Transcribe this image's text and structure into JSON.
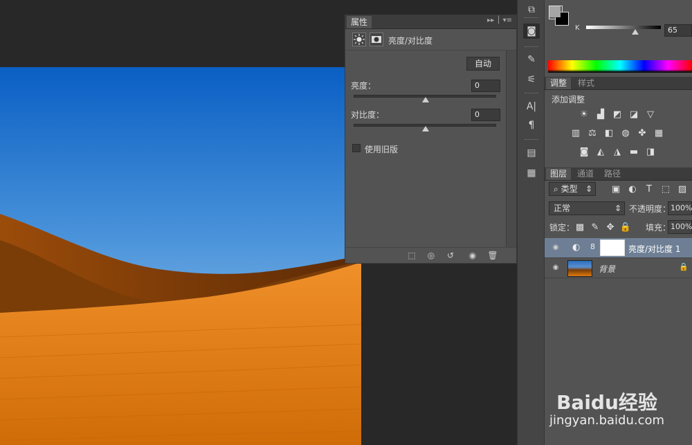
{
  "properties_panel": {
    "tab_title": "属性",
    "adjustment_name": "亮度/对比度",
    "auto_button": "自动",
    "brightness": {
      "label": "亮度：",
      "value": "0"
    },
    "contrast": {
      "label": "对比度：",
      "value": "0"
    },
    "legacy_checkbox": {
      "label": "使用旧版",
      "checked": false
    },
    "tab_menu_icons": [
      "double-chevron-icon",
      "panel-menu-icon"
    ],
    "footer_icons": [
      "clip-to-layer-icon",
      "view-previous-state-icon",
      "reset-icon",
      "visibility-icon",
      "delete-icon"
    ]
  },
  "color_panel": {
    "channel_label": "K",
    "channel_value": "65",
    "channel_level": 0.65,
    "foreground_color": "#a5a5a5",
    "background_color": "#000000"
  },
  "adjustments_panel": {
    "tabs": [
      "调整",
      "样式"
    ],
    "active_tab": "调整",
    "heading": "添加调整",
    "icon_rows": [
      [
        "brightness-icon",
        "levels-icon",
        "curves-icon",
        "exposure-icon",
        "vibrance-icon"
      ],
      [
        "hue-saturation-icon",
        "color-balance-icon",
        "black-white-icon",
        "photo-filter-icon",
        "channel-mixer-icon",
        "color-lookup-icon"
      ],
      [
        "invert-icon",
        "posterize-icon",
        "threshold-icon",
        "gradient-map-icon",
        "selective-color-icon"
      ]
    ]
  },
  "layers_panel": {
    "tabs": [
      "图层",
      "通道",
      "路径"
    ],
    "active_tab": "图层",
    "filter_label": "类型",
    "blend_mode": "正常",
    "opacity_label": "不透明度：",
    "opacity_value": "100%",
    "lock_label": "锁定：",
    "fill_label": "填充：",
    "fill_value": "100%",
    "layers": [
      {
        "name": "亮度/对比度 1",
        "selected": true
      },
      {
        "name": "背景",
        "locked": true
      }
    ]
  },
  "tool_strip": {
    "icons": [
      "history-icon",
      "adjustments-icon",
      "brush-icon",
      "brush-settings-icon",
      "character-icon",
      "paragraph-icon",
      "notes-icon",
      "comments-icon"
    ]
  },
  "watermark": {
    "brand": "Baidu经验",
    "url": "jingyan.baidu.com"
  },
  "colors": {
    "sky_top": "#0a5fc4",
    "sky_bottom": "#a9cdec",
    "sand": "#e07a10",
    "shadow_dune": "#7a3d08"
  }
}
